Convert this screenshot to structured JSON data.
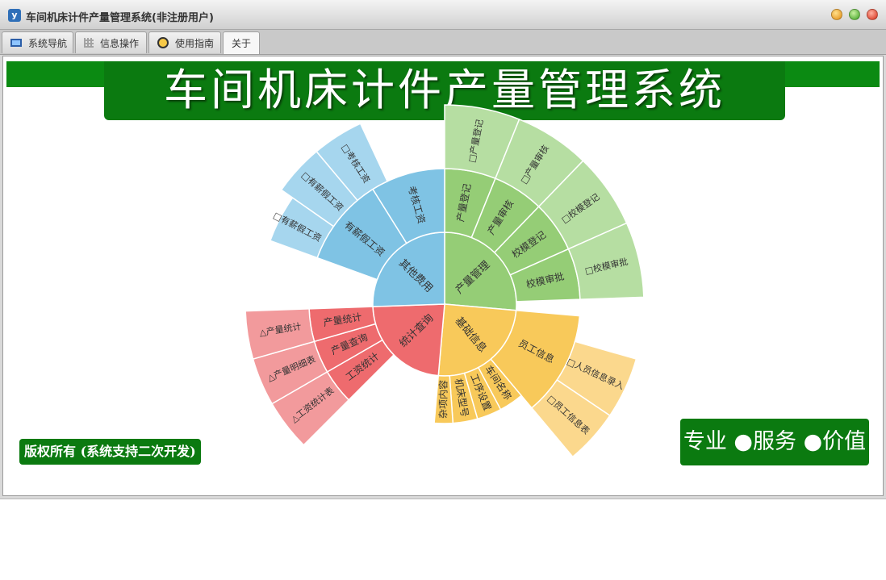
{
  "window": {
    "title": "车间机床计件产量管理系统(非注册用户)",
    "app_icon": "y-app-icon",
    "controls": [
      "minimize-icon",
      "maximize-icon",
      "close-icon"
    ]
  },
  "tabs": [
    {
      "label": "系统导航",
      "icon": "monitor-icon"
    },
    {
      "label": "信息操作",
      "icon": "grid-icon"
    },
    {
      "label": "使用指南",
      "icon": "bulb-icon"
    },
    {
      "label": "关于",
      "icon": ""
    }
  ],
  "active_tab": "关于",
  "banner": {
    "title": "车间机床计件产量管理系统"
  },
  "colors": {
    "green": "#0b7a10",
    "blue": "#7fc3e4",
    "blue_light": "#a6d6ee",
    "lime": "#95cd76",
    "lime_light": "#b6dea2",
    "orange": "#f8c95a",
    "orange_light": "#fbd88d",
    "red": "#ee6b6e",
    "red_light": "#f29a9c"
  },
  "sunburst": {
    "groups": [
      {
        "label": "产量管理",
        "color": "green",
        "children": [
          {
            "label": "产量登记",
            "leaf": "□产量登记"
          },
          {
            "label": "产量审核",
            "leaf": "□产量审核"
          },
          {
            "label": "校模登记",
            "leaf": "□校模登记"
          },
          {
            "label": "校模审批",
            "leaf": "□校模审批"
          }
        ]
      },
      {
        "label": "基础信息",
        "color": "orange",
        "children": [
          {
            "label": "员工信息",
            "leaves": [
              "□人员信息录入",
              "□员工信息表"
            ]
          },
          {
            "label": "车间名称"
          },
          {
            "label": "工序设置"
          },
          {
            "label": "机床型号"
          },
          {
            "label": "杂项内容"
          }
        ]
      },
      {
        "label": "统计查询",
        "color": "red",
        "children": [
          {
            "label": "工资统计",
            "leaf": "△工资统计表"
          },
          {
            "label": "产量查询",
            "leaf": "△产量明细表"
          },
          {
            "label": "产量统计",
            "leaf": "△产量统计"
          }
        ]
      },
      {
        "label": "其他费用",
        "color": "blue",
        "children": [
          {
            "label": "有薪假工资",
            "leaf": "□有薪假工资"
          },
          {
            "label": "考核工资",
            "leaves": [
              "□有薪假工资",
              "□考核工资"
            ]
          }
        ]
      }
    ]
  },
  "footer": {
    "copyright": "版权所有 (系统支持二次开发)",
    "slogan": "专业 ●服务 ●价值"
  }
}
